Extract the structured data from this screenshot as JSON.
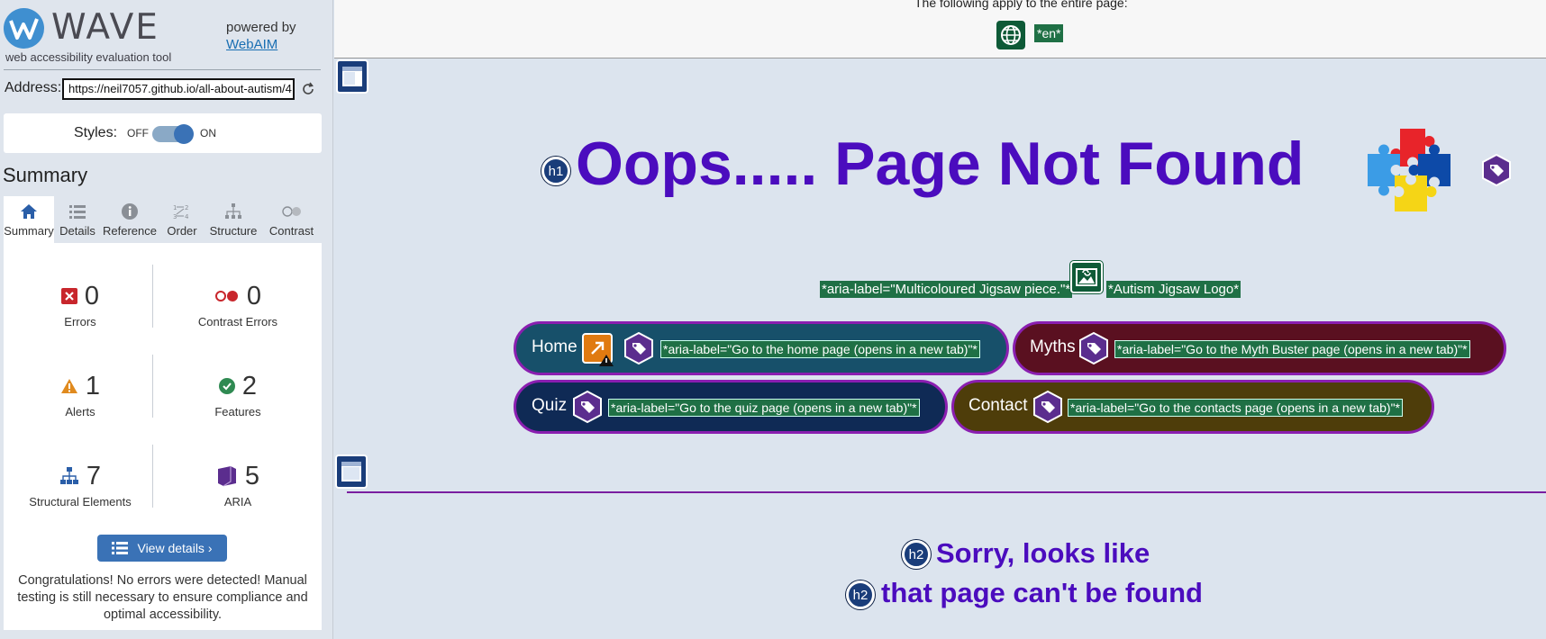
{
  "brand": {
    "name": "WAVE",
    "subtitle": "web accessibility evaluation tool",
    "powered_by": "powered by",
    "powered_link": "WebAIM"
  },
  "address": {
    "label": "Address:",
    "value": "https://neil7057.github.io/all-about-autism/4"
  },
  "styles": {
    "label": "Styles:",
    "off": "OFF",
    "on": "ON",
    "enabled": true
  },
  "summary": {
    "title": "Summary",
    "tabs": [
      {
        "label": "Summary",
        "icon": "home-icon",
        "active": true
      },
      {
        "label": "Details",
        "icon": "list-icon"
      },
      {
        "label": "Reference",
        "icon": "info-icon"
      },
      {
        "label": "Order",
        "icon": "order-icon"
      },
      {
        "label": "Structure",
        "icon": "hierarchy-icon"
      },
      {
        "label": "Contrast",
        "icon": "contrast-icon"
      }
    ],
    "stats": [
      {
        "count": "0",
        "label": "Errors",
        "icon": "error-icon",
        "color": "#c8262c"
      },
      {
        "count": "0",
        "label": "Contrast Errors",
        "icon": "contrast-error-icon",
        "color": "#c8262c"
      },
      {
        "count": "1",
        "label": "Alerts",
        "icon": "alert-icon",
        "color": "#e08a1e"
      },
      {
        "count": "2",
        "label": "Features",
        "icon": "feature-check-icon",
        "color": "#2f8a52"
      },
      {
        "count": "7",
        "label": "Structural Elements",
        "icon": "structure-icon",
        "color": "#2a5ea8"
      },
      {
        "count": "5",
        "label": "ARIA",
        "icon": "aria-icon",
        "color": "#5b2d8e"
      }
    ],
    "view_details": "View details ›",
    "congrats": "Congratulations! No errors were detected! Manual testing is still necessary to ensure compliance and optimal accessibility."
  },
  "page": {
    "top_note": "The following apply to the entire page:",
    "lang_badge": "*en*",
    "h1_badge": "h1",
    "h1": "Oops..... Page Not Found",
    "logo_aria": "*aria-label=\"Multicoloured Jigsaw piece.\"*",
    "logo_alt": "*Autism Jigsaw Logo*",
    "nav": [
      {
        "label": "Home",
        "aria": "*aria-label=\"Go to the home page (opens in a new tab)\"*",
        "color": "#17506a"
      },
      {
        "label": "Myths",
        "aria": "*aria-label=\"Go to the Myth Buster page (opens in a new tab)\"*",
        "color": "#5a1020"
      },
      {
        "label": "Quiz",
        "aria": "*aria-label=\"Go to the quiz page (opens in a new tab)\"*",
        "color": "#0f2a55"
      },
      {
        "label": "Contact",
        "aria": "*aria-label=\"Go to the contacts page (opens in a new tab)\"*",
        "color": "#4e3d0a"
      }
    ],
    "h2_badge": "h2",
    "h2_lines": [
      "Sorry, looks like",
      "that page can't be found"
    ]
  }
}
